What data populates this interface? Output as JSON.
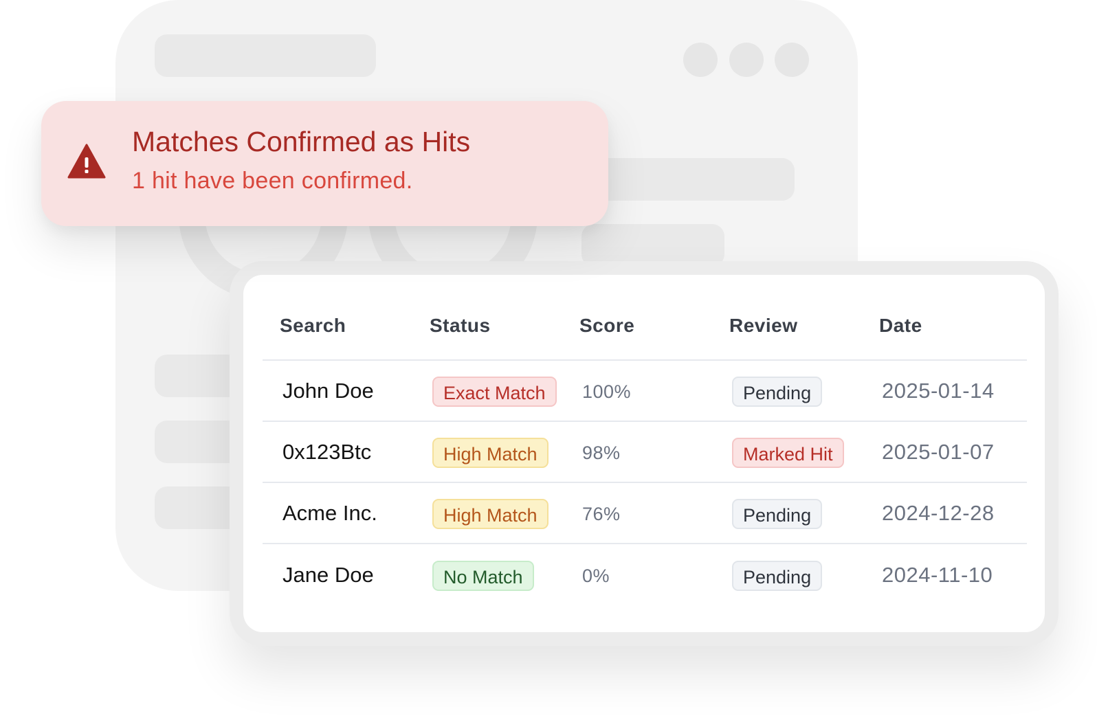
{
  "alert": {
    "title": "Matches Confirmed as Hits",
    "message": "1 hit have been confirmed.",
    "icon": "warning-triangle-icon",
    "colors": {
      "background": "#f9e1e1",
      "title": "#a72a24",
      "message": "#d8473d"
    }
  },
  "table": {
    "headers": {
      "search": "Search",
      "status": "Status",
      "score": "Score",
      "review": "Review",
      "date": "Date"
    },
    "rows": [
      {
        "search": "John Doe",
        "status": "Exact Match",
        "status_color": "red",
        "score": "100%",
        "review": "Pending",
        "review_color": "gray",
        "date": "2025-01-14"
      },
      {
        "search": "0x123Btc",
        "status": "High Match",
        "status_color": "yellow",
        "score": "98%",
        "review": "Marked Hit",
        "review_color": "red",
        "date": "2025-01-07"
      },
      {
        "search": "Acme Inc.",
        "status": "High Match",
        "status_color": "yellow",
        "score": "76%",
        "review": "Pending",
        "review_color": "gray",
        "date": "2024-12-28"
      },
      {
        "search": "Jane Doe",
        "status": "No Match",
        "status_color": "green",
        "score": "0%",
        "review": "Pending",
        "review_color": "gray",
        "date": "2024-11-10"
      }
    ]
  }
}
